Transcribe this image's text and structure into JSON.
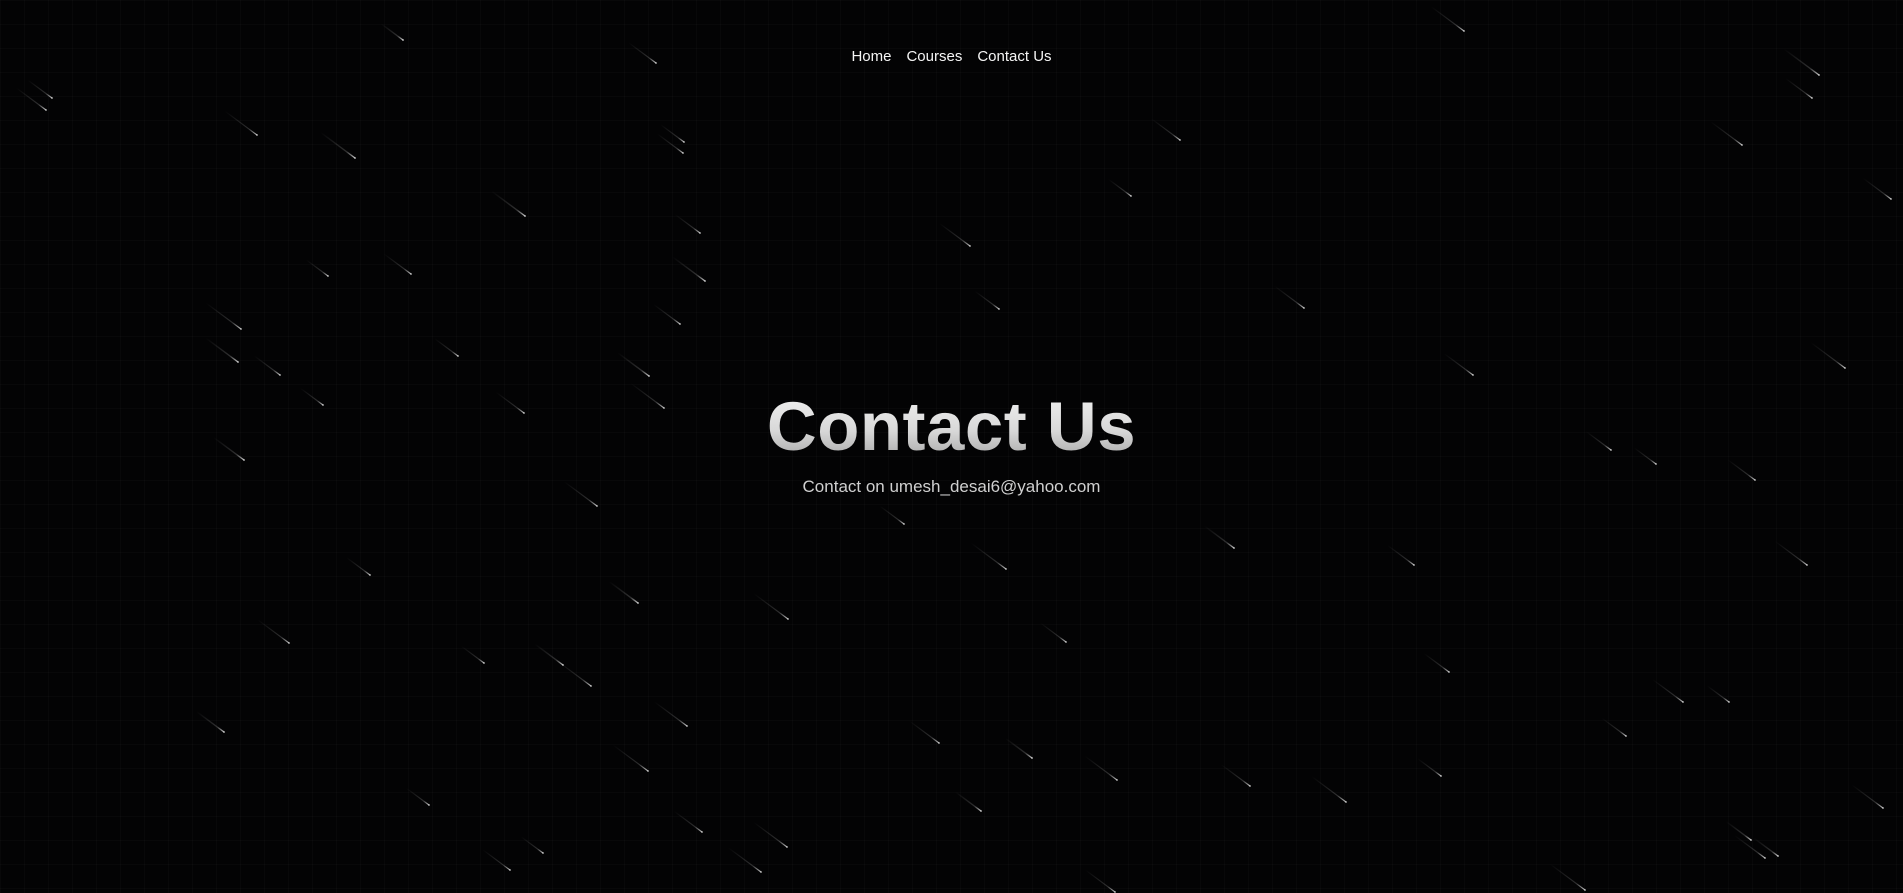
{
  "nav": {
    "items": [
      {
        "label": "Home"
      },
      {
        "label": "Courses"
      },
      {
        "label": "Contact Us"
      }
    ]
  },
  "hero": {
    "title": "Contact Us",
    "subtitle": "Contact on umesh_desai6@yahoo.com"
  },
  "colors": {
    "background": "#030304",
    "text": "#f5f5f5",
    "subtitle": "#d0d0d0",
    "meteor": "#ffffff"
  }
}
